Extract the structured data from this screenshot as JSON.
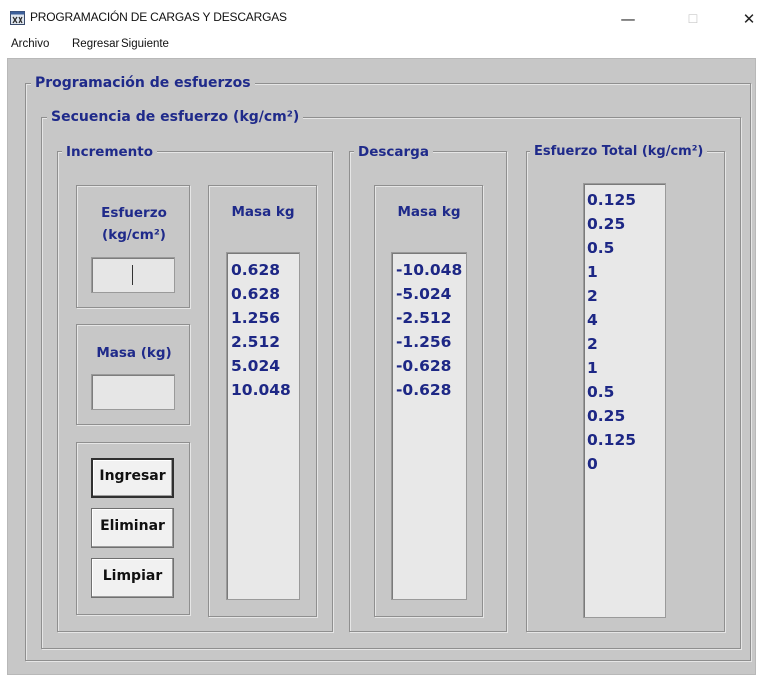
{
  "window": {
    "title": "PROGRAMACIÓN DE CARGAS Y DESCARGAS",
    "app_icon": "app-window-icon",
    "controls": {
      "minimize": "—",
      "maximize": "☐",
      "close": "✕"
    }
  },
  "menu": {
    "items": [
      "Archivo",
      "Regresar",
      "Siguiente"
    ]
  },
  "groups": {
    "programacion": "Programación de esfuerzos",
    "secuencia": "Secuencia de esfuerzo (kg/cm²)",
    "incremento": "Incremento",
    "descarga": "Descarga",
    "total": "Esfuerzo Total (kg/cm²)"
  },
  "incremento": {
    "esfuerzo_label": "Esfuerzo (kg/cm²)",
    "esfuerzo_value": "",
    "masa_label": "Masa (kg)",
    "masa_value": "",
    "buttons": {
      "ingresar": "Ingresar",
      "eliminar": "Eliminar",
      "limpiar": "Limpiar"
    },
    "masa_header": "Masa kg",
    "masa_list": [
      "0.628",
      "0.628",
      "1.256",
      "2.512",
      "5.024",
      "10.048"
    ]
  },
  "descarga": {
    "masa_header": "Masa kg",
    "masa_list": [
      "-10.048",
      "-5.024",
      "-2.512",
      "-1.256",
      "-0.628",
      "-0.628"
    ]
  },
  "total": {
    "list": [
      "0.125",
      "0.25",
      "0.5",
      "1",
      "2",
      "4",
      "2",
      "1",
      "0.5",
      "0.25",
      "0.125",
      "0"
    ]
  },
  "colors": {
    "label_blue": "#1f2a8a",
    "value_blue": "#1d2785",
    "panel": "#c7c7c7"
  }
}
